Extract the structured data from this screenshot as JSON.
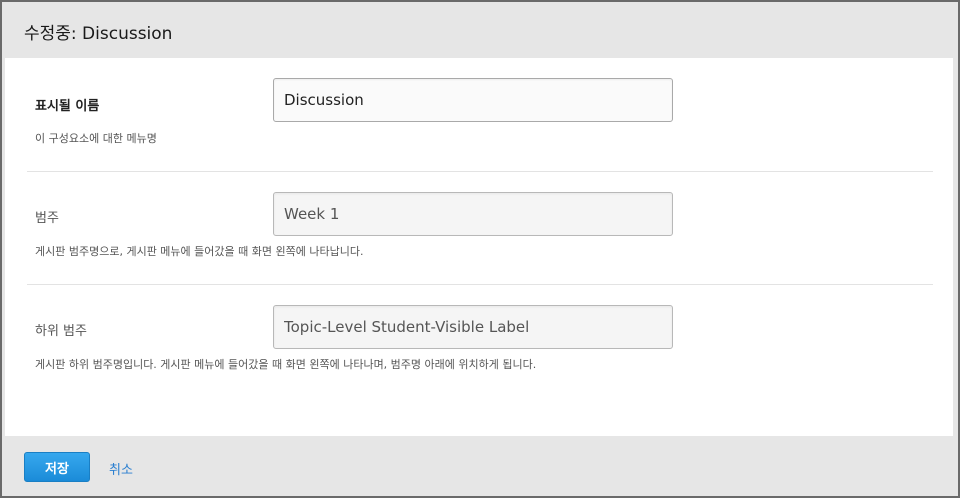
{
  "header": {
    "title": "수정중: Discussion"
  },
  "fields": [
    {
      "label": "표시될 이름",
      "help": "이 구성요소에 대한 메뉴명",
      "value": "Discussion",
      "placeholder": ""
    },
    {
      "label": "범주",
      "help": "게시판 범주명으로, 게시판 메뉴에 들어갔을 때 화면 왼쪽에 나타납니다.",
      "value": "",
      "placeholder": "Week 1"
    },
    {
      "label": "하위 범주",
      "help": "게시판 하위 범주명입니다. 게시판 메뉴에 들어갔을 때 화면 왼쪽에 나타나며, 범주명 아래에 위치하게 됩니다.",
      "value": "",
      "placeholder": "Topic-Level Student-Visible Label"
    }
  ],
  "footer": {
    "save_label": "저장",
    "cancel_label": "취소"
  },
  "colors": {
    "accent": "#1b8bd8",
    "link": "#2a7fd0",
    "chrome": "#e6e6e6"
  }
}
